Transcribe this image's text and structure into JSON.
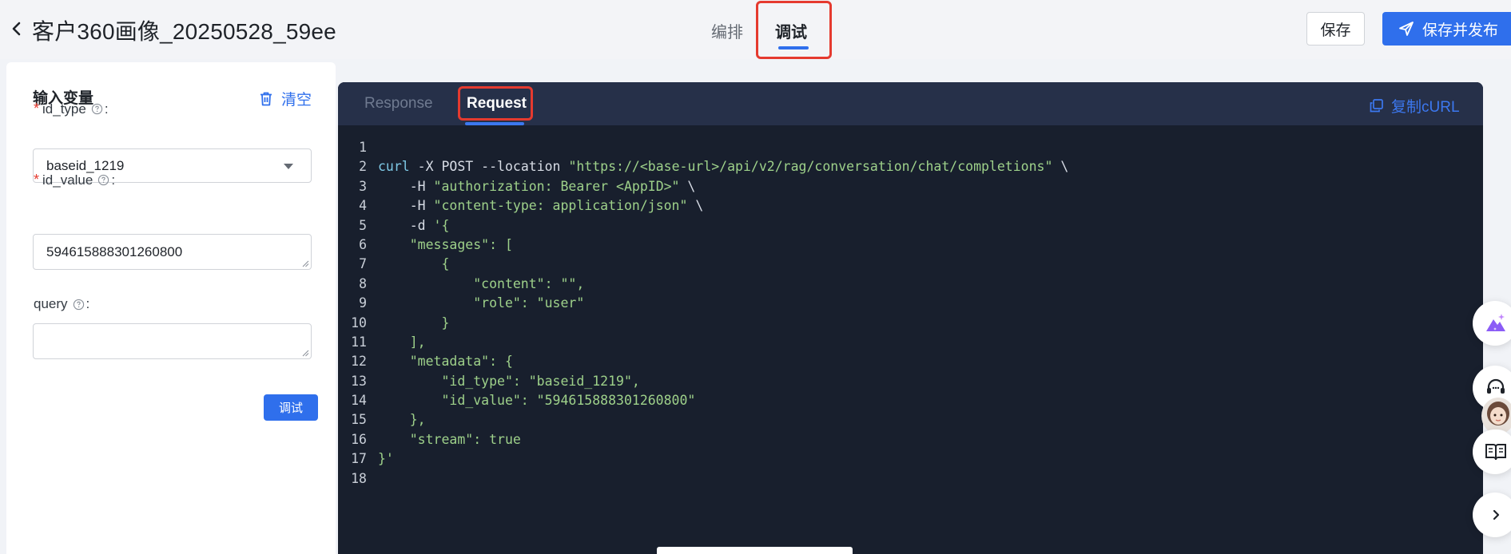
{
  "header": {
    "title": "客户360画像_20250528_59ee",
    "tabs": [
      {
        "label": "编排",
        "active": false
      },
      {
        "label": "调试",
        "active": true
      }
    ],
    "save_label": "保存",
    "publish_label": "保存并发布"
  },
  "left_panel": {
    "title": "输入变量",
    "clear_label": "清空",
    "fields": [
      {
        "name": "id_type",
        "required": true,
        "type": "select",
        "value": "baseid_1219"
      },
      {
        "name": "id_value",
        "required": true,
        "type": "textarea",
        "value": "594615888301260800"
      },
      {
        "name": "query",
        "required": false,
        "type": "textarea",
        "value": ""
      }
    ],
    "debug_button_label": "调试"
  },
  "code_panel": {
    "tabs": [
      {
        "label": "Response",
        "active": false
      },
      {
        "label": "Request",
        "active": true
      }
    ],
    "copy_label": "复制cURL",
    "lines": [
      [],
      [
        [
          "kw",
          "curl"
        ],
        [
          "p",
          " -X POST --location "
        ],
        [
          "s",
          "\"https://<base-url>/api/v2/rag/conversation/chat/completions\""
        ],
        [
          "p",
          " \\"
        ]
      ],
      [
        [
          "p",
          "    -H "
        ],
        [
          "s",
          "\"authorization: Bearer <AppID>\""
        ],
        [
          "p",
          " \\"
        ]
      ],
      [
        [
          "p",
          "    -H "
        ],
        [
          "s",
          "\"content-type: application/json\""
        ],
        [
          "p",
          " \\"
        ]
      ],
      [
        [
          "p",
          "    -d "
        ],
        [
          "s",
          "'{"
        ]
      ],
      [
        [
          "s",
          "    \"messages\": ["
        ]
      ],
      [
        [
          "s",
          "        {"
        ]
      ],
      [
        [
          "s",
          "            \"content\": \"\","
        ]
      ],
      [
        [
          "s",
          "            \"role\": \"user\""
        ]
      ],
      [
        [
          "s",
          "        }"
        ]
      ],
      [
        [
          "s",
          "    ],"
        ]
      ],
      [
        [
          "s",
          "    \"metadata\": {"
        ]
      ],
      [
        [
          "s",
          "        \"id_type\": \"baseid_1219\","
        ]
      ],
      [
        [
          "s",
          "        \"id_value\": \"594615888301260800\""
        ]
      ],
      [
        [
          "s",
          "    },"
        ]
      ],
      [
        [
          "s",
          "    \"stream\": true"
        ]
      ],
      [
        [
          "s",
          "}'"
        ]
      ],
      []
    ]
  },
  "colors": {
    "primary": "#2f6fec",
    "required": "#e53a2f",
    "highlight_box": "#e53a2f",
    "code_bg": "#181f2d",
    "code_string": "#9ed18a",
    "code_keyword": "#7ec9e6"
  },
  "icons": [
    "back-chevron-icon",
    "send-icon",
    "trash-icon",
    "help-circle-icon",
    "copy-icon",
    "ai-assistant-icon",
    "headset-icon",
    "book-icon",
    "chevron-right-icon"
  ]
}
